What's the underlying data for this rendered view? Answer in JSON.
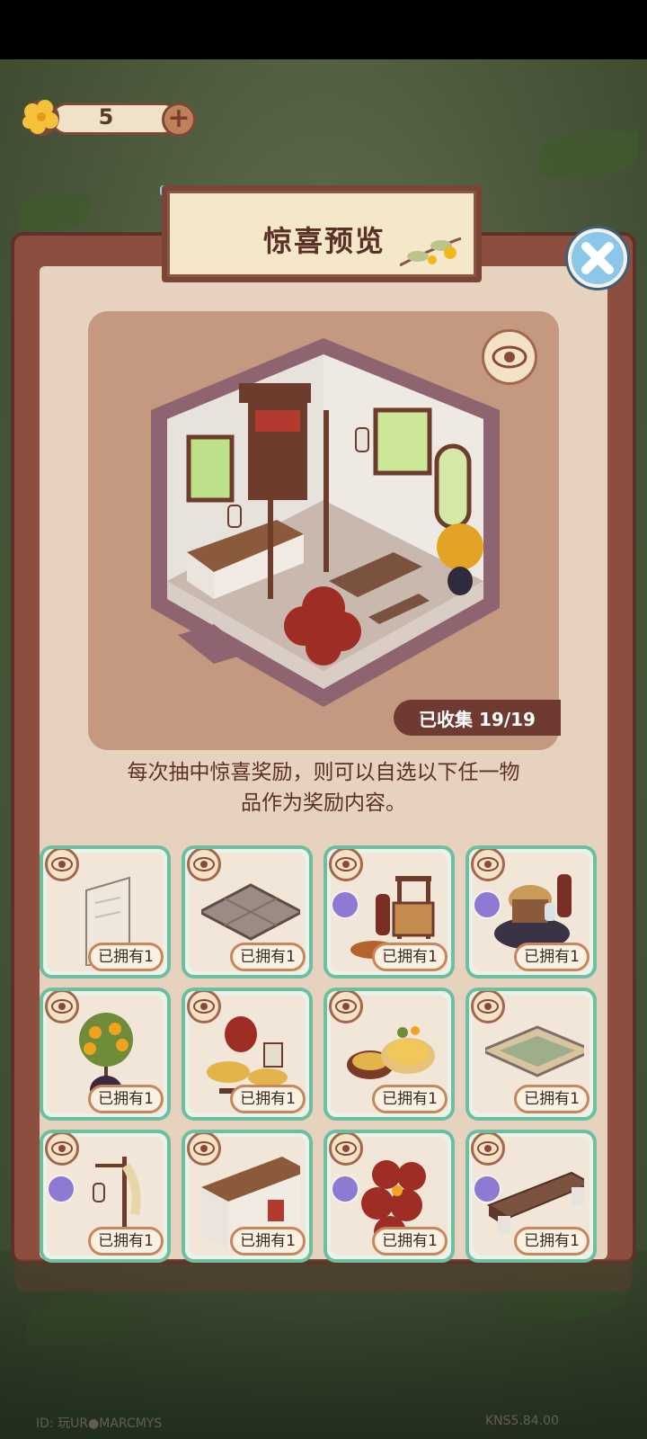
{
  "currency": {
    "amount": "5",
    "plus_label": "+"
  },
  "dialog": {
    "title": "惊喜预览",
    "collected_label": "已收集 19/19",
    "description_line1": "每次抽中惊喜奖励，则可以自选以下任一物",
    "description_line2": "品作为奖励内容。"
  },
  "items": [
    {
      "owned": "已拥有1",
      "icon": "scroll-painting",
      "badge": false
    },
    {
      "owned": "已拥有1",
      "icon": "stone-floor-tile",
      "badge": false
    },
    {
      "owned": "已拥有1",
      "icon": "food-stall",
      "badge": true
    },
    {
      "owned": "已拥有1",
      "icon": "hotpot-table",
      "badge": true
    },
    {
      "owned": "已拥有1",
      "icon": "osmanthus-tree-pot",
      "badge": false
    },
    {
      "owned": "已拥有1",
      "icon": "wine-jar-and-cakes",
      "badge": false
    },
    {
      "owned": "已拥有1",
      "icon": "osmanthus-cakes",
      "badge": false
    },
    {
      "owned": "已拥有1",
      "icon": "floor-rug",
      "badge": false
    },
    {
      "owned": "已拥有1",
      "icon": "lantern-pole",
      "badge": true
    },
    {
      "owned": "已拥有1",
      "icon": "counter-table",
      "badge": false
    },
    {
      "owned": "已拥有1",
      "icon": "stacked-wine-jars",
      "badge": true
    },
    {
      "owned": "已拥有1",
      "icon": "wooden-bench",
      "badge": true
    }
  ],
  "watermark": {
    "left": "ID: 玩UR●MARCMYS",
    "right": "KNS5.84.00"
  },
  "colors": {
    "panel": "#8c4e3e",
    "panel_inner": "#e6d2bf",
    "card_border": "#6dbfa0",
    "badge": "#8f7ad3",
    "close": "#8cc6e8"
  }
}
